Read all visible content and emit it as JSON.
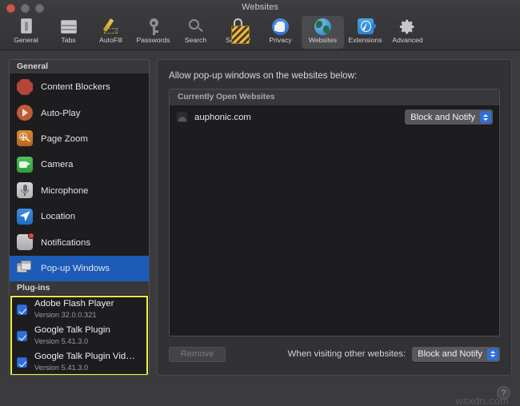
{
  "window": {
    "title": "Websites",
    "traffic_lights": [
      "close",
      "minimize",
      "maximize"
    ]
  },
  "toolbar": {
    "items": [
      {
        "label": "General",
        "icon": "general-icon",
        "selected": false
      },
      {
        "label": "Tabs",
        "icon": "tabs-icon",
        "selected": false
      },
      {
        "label": "AutoFill",
        "icon": "autofill-icon",
        "selected": false
      },
      {
        "label": "Passwords",
        "icon": "key-icon",
        "selected": false
      },
      {
        "label": "Search",
        "icon": "search-icon",
        "selected": false
      },
      {
        "label": "Security",
        "icon": "lock-icon",
        "selected": false
      },
      {
        "label": "Privacy",
        "icon": "hand-icon",
        "selected": false
      },
      {
        "label": "Websites",
        "icon": "globe-icon",
        "selected": true
      },
      {
        "label": "Extensions",
        "icon": "puzzle-icon",
        "selected": false
      },
      {
        "label": "Advanced",
        "icon": "gear-icon",
        "selected": false
      }
    ]
  },
  "sidebar": {
    "general_header": "General",
    "general_items": [
      {
        "label": "Content Blockers",
        "icon": "content-blockers-icon",
        "selected": false
      },
      {
        "label": "Auto-Play",
        "icon": "auto-play-icon",
        "selected": false
      },
      {
        "label": "Page Zoom",
        "icon": "page-zoom-icon",
        "selected": false
      },
      {
        "label": "Camera",
        "icon": "camera-icon",
        "selected": false
      },
      {
        "label": "Microphone",
        "icon": "microphone-icon",
        "selected": false
      },
      {
        "label": "Location",
        "icon": "location-icon",
        "selected": false
      },
      {
        "label": "Notifications",
        "icon": "notifications-icon",
        "selected": false
      },
      {
        "label": "Pop-up Windows",
        "icon": "popup-windows-icon",
        "selected": true
      }
    ],
    "plugins_header": "Plug-ins",
    "plugins": [
      {
        "name": "Adobe Flash Player",
        "version": "Version 32.0.0.321",
        "checked": true
      },
      {
        "name": "Google Talk Plugin",
        "version": "Version 5.41.3.0",
        "checked": true
      },
      {
        "name": "Google Talk Plugin Vid…",
        "version": "Version 5.41.3.0",
        "checked": true
      }
    ],
    "highlight_color": "#f5f03c"
  },
  "main": {
    "description": "Allow pop-up windows on the websites below:",
    "list_header": "Currently Open Websites",
    "rows": [
      {
        "site": "auphonic.com",
        "setting": "Block and Notify"
      }
    ],
    "remove_button": "Remove",
    "visiting_label": "When visiting other websites:",
    "default_setting": "Block and Notify"
  },
  "footer": {
    "help": "?",
    "watermark": "wsxdn.com"
  },
  "colors": {
    "accent_blue": "#2f6fd8",
    "selection_blue": "#1d5bb8",
    "highlight_yellow": "#f5f03c",
    "window_bg": "#3b3b3d",
    "list_bg": "#1d1d1f"
  }
}
